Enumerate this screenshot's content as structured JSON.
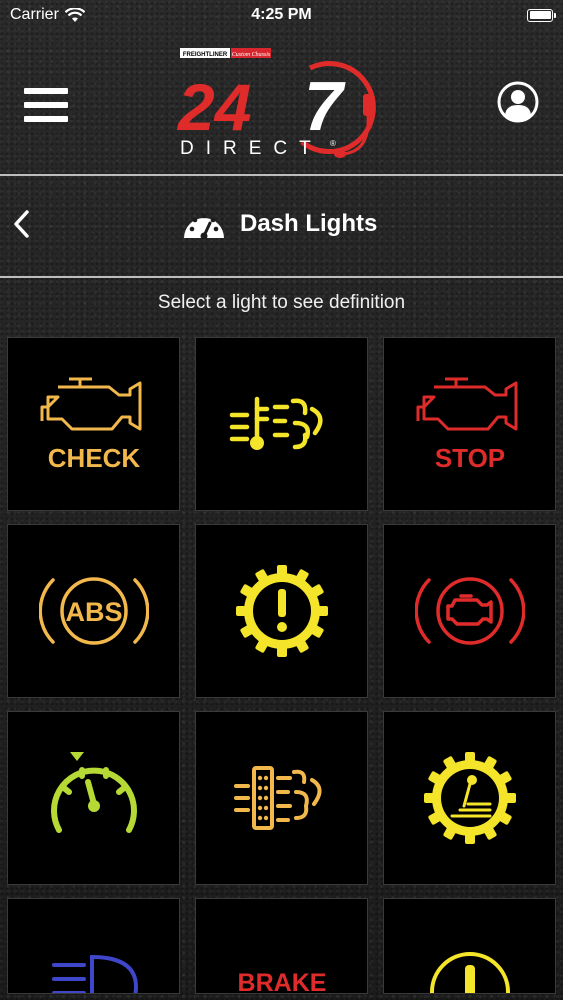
{
  "status_bar": {
    "carrier": "Carrier",
    "time": "4:25 PM"
  },
  "header": {
    "logo": {
      "brand_top_left": "FREIGHTLINER",
      "brand_top_right": "Custom Chassis",
      "number_left": "24",
      "number_right": "7",
      "wordmark": "DIRECT",
      "registered": "®"
    },
    "menu_icon": "hamburger-icon",
    "account_icon": "user-icon"
  },
  "nav": {
    "title": "Dash Lights",
    "back_icon": "chevron-left-icon",
    "title_icon": "speedometer-icon"
  },
  "instruction": "Select a light to see definition",
  "colors": {
    "amber": "#f2b84b",
    "yellow": "#f4e52a",
    "red": "#e02b2b",
    "green": "#b6d935",
    "blue": "#3e46c9"
  },
  "lights": [
    {
      "icon": "check-engine-icon",
      "label": "CHECK",
      "color": "#f2b84b"
    },
    {
      "icon": "coolant-exhaust-icon",
      "label": "",
      "color": "#f4e52a"
    },
    {
      "icon": "stop-engine-icon",
      "label": "STOP",
      "color": "#e02b2b"
    },
    {
      "icon": "abs-icon",
      "label": "ABS",
      "color": "#f2b84b"
    },
    {
      "icon": "warning-gear-icon",
      "label": "!",
      "color": "#f4e52a"
    },
    {
      "icon": "engine-brake-icon",
      "label": "",
      "color": "#e02b2b"
    },
    {
      "icon": "cruise-control-icon",
      "label": "",
      "color": "#b6d935"
    },
    {
      "icon": "dpf-regen-icon",
      "label": "",
      "color": "#f2b84b"
    },
    {
      "icon": "transmission-gear-icon",
      "label": "",
      "color": "#f4e52a"
    },
    {
      "icon": "headlight-icon",
      "label": "",
      "color": "#3e46c9"
    },
    {
      "icon": "brake-text-icon",
      "label": "BRAKE",
      "color": "#e02b2b"
    },
    {
      "icon": "circle-warning-icon",
      "label": "",
      "color": "#f4e52a"
    }
  ]
}
